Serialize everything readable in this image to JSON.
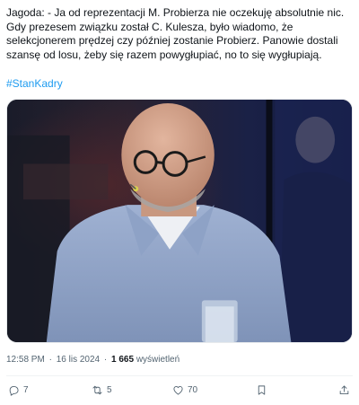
{
  "tweet": {
    "lines": [
      "Jagoda: - Ja od reprezentacji M. Probierza nie oczekuję absolutnie nic.",
      "Gdy prezesem związku został C. Kulesza, było wiadomo, że",
      "selekcjonerem prędzej czy później zostanie Probierz. Panowie dostali",
      "szansę od losu, żeby się razem powygłupiać, no to się wygłupiają."
    ],
    "hashtag": "#StanKadry"
  },
  "meta": {
    "time": "12:58 PM",
    "separator": "·",
    "date": "16 lis 2024",
    "views_count": "1 665",
    "views_label": "wyświetleń"
  },
  "actions": {
    "replies": {
      "icon": "reply-icon",
      "count": "7"
    },
    "reposts": {
      "icon": "repost-icon",
      "count": "5"
    },
    "likes": {
      "icon": "heart-icon",
      "count": "70"
    },
    "bookmark": {
      "icon": "bookmark-icon"
    },
    "share": {
      "icon": "share-icon"
    }
  },
  "colors": {
    "text": "#0f1419",
    "secondary": "#536471",
    "link": "#1d9bf0",
    "divider": "#eff3f4"
  }
}
